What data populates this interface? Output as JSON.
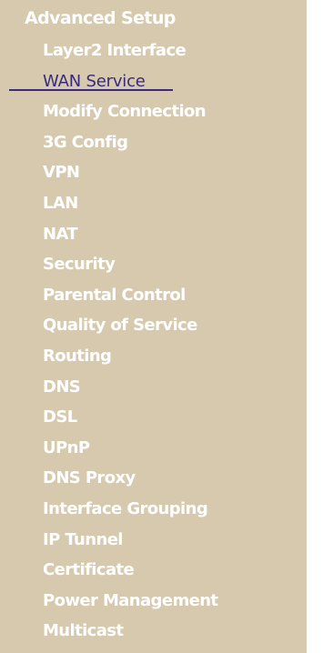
{
  "nav": {
    "header": "Advanced Setup",
    "items": [
      {
        "label": "Layer2 Interface"
      },
      {
        "label": "WAN Service"
      },
      {
        "label": "Modify Connection"
      },
      {
        "label": "3G Config"
      },
      {
        "label": "VPN"
      },
      {
        "label": "LAN"
      },
      {
        "label": "NAT"
      },
      {
        "label": "Security"
      },
      {
        "label": "Parental Control"
      },
      {
        "label": "Quality of Service"
      },
      {
        "label": "Routing"
      },
      {
        "label": "DNS"
      },
      {
        "label": "DSL"
      },
      {
        "label": "UPnP"
      },
      {
        "label": "DNS Proxy"
      },
      {
        "label": "Interface Grouping"
      },
      {
        "label": "IP Tunnel"
      },
      {
        "label": "Certificate"
      },
      {
        "label": "Power Management"
      },
      {
        "label": "Multicast"
      }
    ],
    "selected": "WAN Service"
  },
  "colors": {
    "panel_background": "#d6c9ad",
    "item_text": "#ffffff",
    "selected_text": "#3a2a80"
  }
}
